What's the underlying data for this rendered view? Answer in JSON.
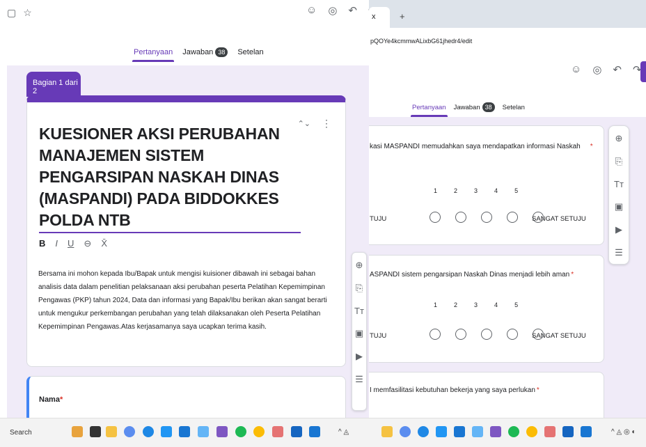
{
  "left": {
    "header_icons": [
      "folder-icon",
      "star-icon"
    ],
    "header_right_icons": [
      "palette-icon",
      "preview-icon",
      "undo-icon",
      "redo-icon"
    ],
    "tabs": [
      {
        "label": "Pertanyaan",
        "active": true
      },
      {
        "label": "Jawaban",
        "badge": "38"
      },
      {
        "label": "Setelan"
      }
    ],
    "section_label": "Bagian 1 dari 2",
    "form_title": "KUESIONER AKSI PERUBAHAN MANAJEMEN SISTEM PENGARSIPAN NASKAH DINAS (MASPANDI) PADA BIDDOKKES POLDA NTB",
    "format_buttons": [
      "B",
      "I",
      "U",
      "⊖",
      "X̄"
    ],
    "description": "Bersama ini mohon kepada Ibu/Bapak untuk mengisi kuisioner dibawah ini sebagai bahan analisis data dalam penelitian pelaksanaan aksi perubahan peserta Pelatihan Kepemimpinan Pengawas (PKP) tahun 2024, Data dan informasi yang Bapak/Ibu berikan akan sangat berarti untuk mengukur perkembangan perubahan yang telah dilaksanakan oleh Peserta Pelatihan Kepemimpinan Pengawas.Atas kerjasamanya saya ucapkan terima kasih.",
    "question_label": "Nama",
    "required_mark": "*"
  },
  "right": {
    "tab_close": "x",
    "tab_new": "+",
    "url": "pQOYe4kcmmwALixbG61jhedr4/edit",
    "tabs": [
      {
        "label": "Pertanyaan",
        "active": true
      },
      {
        "label": "Jawaban",
        "badge": "38"
      },
      {
        "label": "Setelan"
      }
    ],
    "questions": [
      {
        "text": "kasi MASPANDI memudahkan saya mendapatkan informasi Naskah",
        "required": "*",
        "scale": [
          "1",
          "2",
          "3",
          "4",
          "5"
        ],
        "low": "TUJU",
        "high": "SANGAT SETUJU"
      },
      {
        "text": "ASPANDI sistem pengarsipan Naskah Dinas menjadi lebih aman",
        "required": "*",
        "scale": [
          "1",
          "2",
          "3",
          "4",
          "5"
        ],
        "low": "TUJU",
        "high": "SANGAT SETUJU"
      },
      {
        "text": "I memfasilitasi kebutuhan bekerja yang saya perlukan",
        "required": "*"
      }
    ]
  },
  "toolbar": {
    "items": [
      "add-question-icon",
      "import-icon",
      "title-text-icon",
      "image-icon",
      "video-icon",
      "section-icon"
    ],
    "glyphs": [
      "⊕",
      "⎘",
      "Tт",
      "▣",
      "▶",
      "☰"
    ]
  },
  "taskbar": {
    "search_label": "Search",
    "tray_left": "^ ◬",
    "tray_right": "^ ◬ ◎ ◐"
  },
  "colors": {
    "accent": "#673ab7",
    "form_bg": "#f0ebf8",
    "required": "#d93025"
  }
}
